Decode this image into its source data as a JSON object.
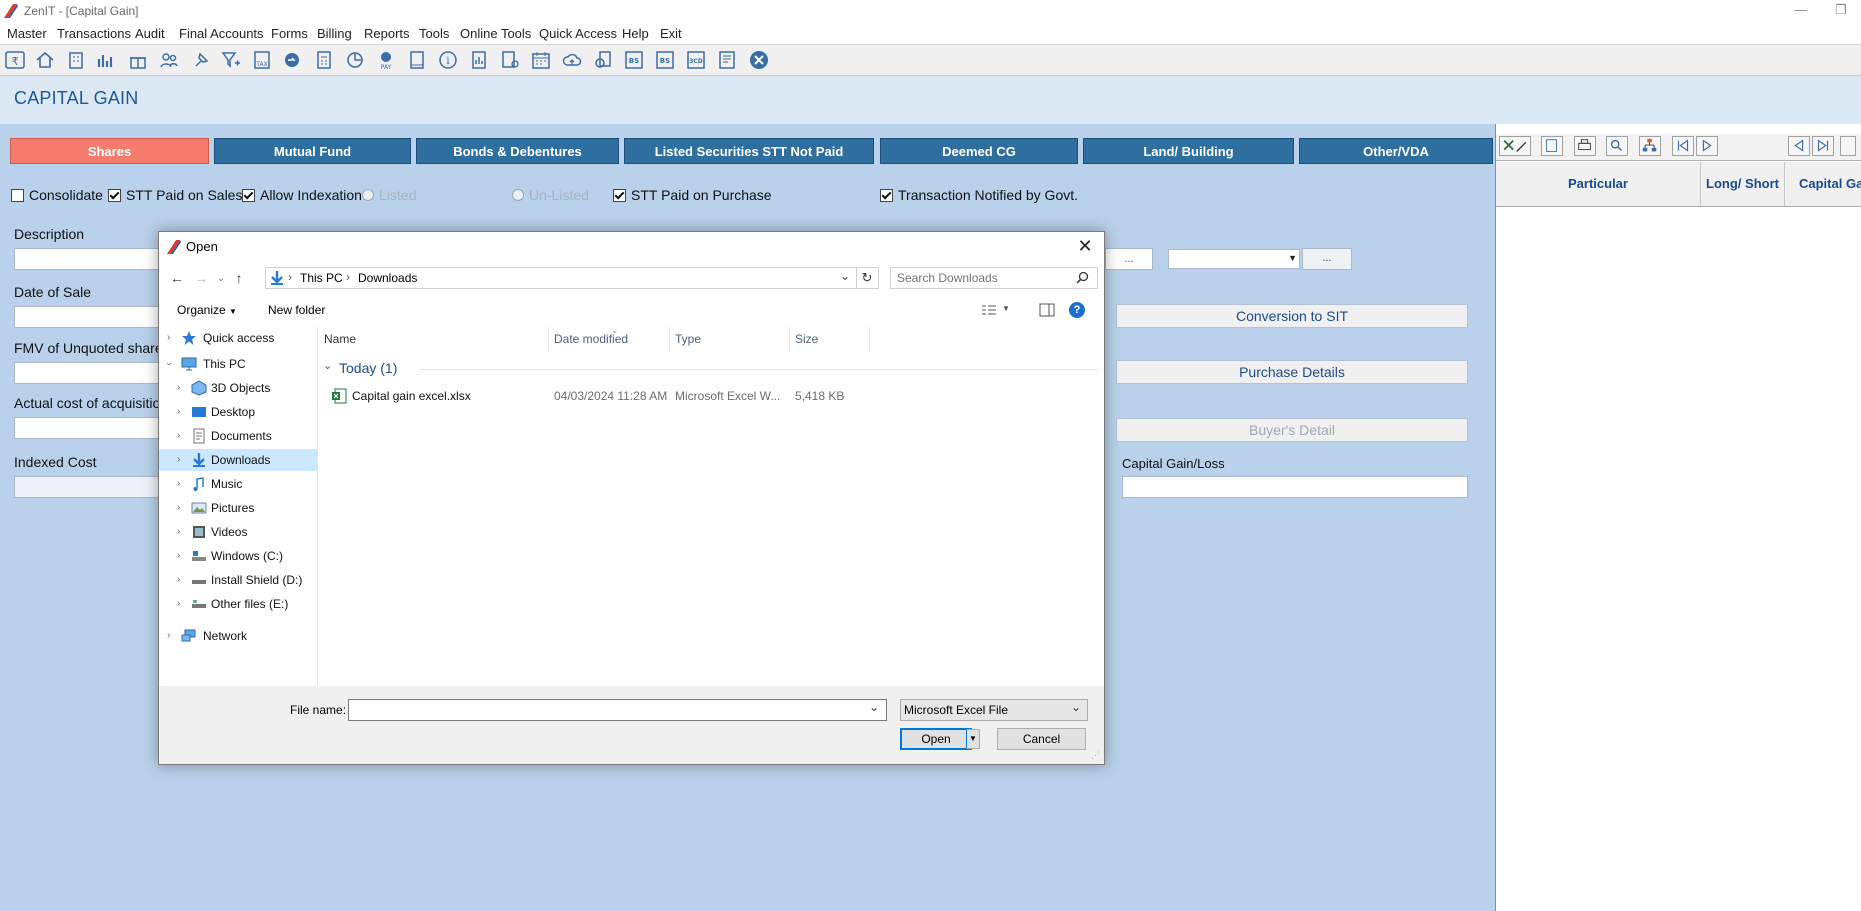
{
  "app": {
    "title": "ZenIT - [Capital Gain]",
    "window_minimize": "—",
    "window_restore": "❐"
  },
  "menu": [
    "Master",
    "Transactions",
    "Audit",
    "Final Accounts",
    "Forms",
    "Billing",
    "Reports",
    "Tools",
    "Online Tools",
    "Quick Access",
    "Help",
    "Exit"
  ],
  "page": {
    "title": "CAPITAL GAIN"
  },
  "tabs": [
    "Shares",
    "Mutual Fund",
    "Bonds & Debentures",
    "Listed Securities STT Not Paid",
    "Deemed CG",
    "Land/ Building",
    "Other/VDA"
  ],
  "active_tab": "Shares",
  "options": {
    "consolidate": {
      "label": "Consolidate",
      "checked": false
    },
    "stt_paid_on_sales": {
      "label": "STT Paid on Sales",
      "checked": true
    },
    "allow_indexation": {
      "label": "Allow Indexation",
      "checked": true
    },
    "listed": {
      "label": "Listed",
      "checked": false
    },
    "unlisted": {
      "label": "Un-Listed",
      "checked": false
    },
    "stt_paid_on_purchase": {
      "label": "STT Paid on Purchase",
      "checked": true
    },
    "transaction_notified": {
      "label": "Transaction Notified by Govt.",
      "checked": true
    }
  },
  "form": {
    "description": "Description",
    "date_of_sale": "Date of Sale",
    "fmv_unquoted": "FMV of Unquoted shares",
    "actual_cost": "Actual cost of acquisition",
    "indexed_cost": "Indexed Cost",
    "capital_gain_loss": "Capital Gain/Loss",
    "ellipsis1": "...",
    "ellipsis2": "..."
  },
  "side_buttons": {
    "conversion": "Conversion to SIT",
    "purchase": "Purchase Details",
    "buyer": "Buyer's Detail"
  },
  "right_grid": {
    "columns": [
      "Particular",
      "Long/ Short",
      "Capital Gain"
    ]
  },
  "dialog": {
    "title": "Open",
    "close": "✕",
    "address": {
      "root": "This PC",
      "sep": "›",
      "folder": "Downloads"
    },
    "search_placeholder": "Search Downloads",
    "organize": "Organize",
    "new_folder": "New folder",
    "help": "?",
    "nav_tree": [
      {
        "label": "Quick access",
        "icon": "star-icon"
      },
      {
        "label": "This PC",
        "icon": "computer-icon"
      },
      {
        "label": "3D Objects",
        "icon": "cube-icon"
      },
      {
        "label": "Desktop",
        "icon": "desktop-icon"
      },
      {
        "label": "Documents",
        "icon": "document-icon"
      },
      {
        "label": "Downloads",
        "icon": "download-icon"
      },
      {
        "label": "Music",
        "icon": "music-icon"
      },
      {
        "label": "Pictures",
        "icon": "picture-icon"
      },
      {
        "label": "Videos",
        "icon": "video-icon"
      },
      {
        "label": "Windows (C:)",
        "icon": "drive-icon"
      },
      {
        "label": "Install Shield (D:)",
        "icon": "drive-icon"
      },
      {
        "label": "Other files (E:)",
        "icon": "drive-icon"
      },
      {
        "label": "Network",
        "icon": "network-icon"
      }
    ],
    "columns": [
      "Name",
      "Date modified",
      "Type",
      "Size"
    ],
    "group": "Today (1)",
    "files": [
      {
        "name": "Capital gain excel.xlsx",
        "date": "04/03/2024 11:28 AM",
        "type": "Microsoft Excel W...",
        "size": "5,418 KB"
      }
    ],
    "file_name_label": "File name:",
    "file_name_value": "",
    "file_type": "Microsoft Excel File",
    "open_button": "Open",
    "cancel_button": "Cancel"
  },
  "colors": {
    "background": "#b9d1ea",
    "tab": "#2f6fa0",
    "active_tab": "#f57b6d",
    "title_text": "#1a5a9a",
    "selection": "#cce8ff"
  }
}
